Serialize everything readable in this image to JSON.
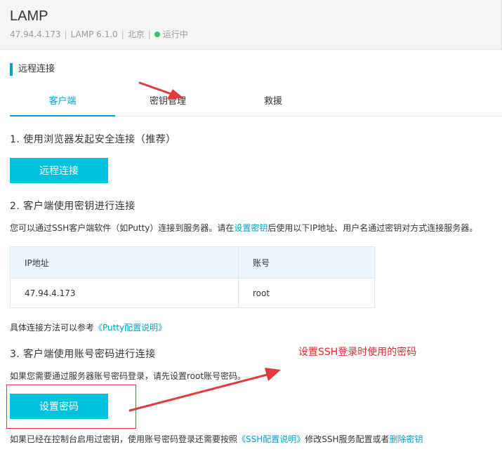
{
  "header": {
    "title": "LAMP",
    "ip": "47.94.4.173",
    "image": "LAMP  6.1.0",
    "region": "北京",
    "status": "运行中",
    "status_color": "#3fbf6b"
  },
  "section": {
    "title": "远程连接"
  },
  "tabs": [
    {
      "label": "客户端",
      "active": true
    },
    {
      "label": "密钥管理",
      "active": false
    },
    {
      "label": "救援",
      "active": false
    }
  ],
  "step1": {
    "title": "1. 使用浏览器发起安全连接（推荐）",
    "button": "远程连接"
  },
  "step2": {
    "title": "2. 客户端使用密钥进行连接",
    "desc_before": "您可以通过SSH客户端软件（如Putty）连接到服务器。请在",
    "desc_link": "设置密钥",
    "desc_after": "后使用以下IP地址、用户名通过密钥对方式连接服务器。",
    "table": {
      "headers": [
        "IP地址",
        "账号"
      ],
      "rows": [
        [
          "47.94.4.173",
          "root"
        ]
      ]
    },
    "ref_before": "具体连接方法可以参考",
    "ref_link": "《Putty配置说明》"
  },
  "step3": {
    "title": "3. 客户端使用账号密码进行连接",
    "desc": "如果您需要通过服务器账号密码登录，请先设置root账号密码。",
    "button": "设置密码",
    "note_before": "如果已经在控制台启用过密钥，使用账号密码登录还需要按照",
    "note_link1": "《SSH配置说明》",
    "note_middle": "修改SSH服务配置或者",
    "note_link2": "删除密钥"
  },
  "annotation": {
    "text": "设置SSH登录时使用的密码",
    "color": "#e02b2b"
  },
  "colors": {
    "accent": "#00a2ca",
    "button": "#00c1de"
  }
}
